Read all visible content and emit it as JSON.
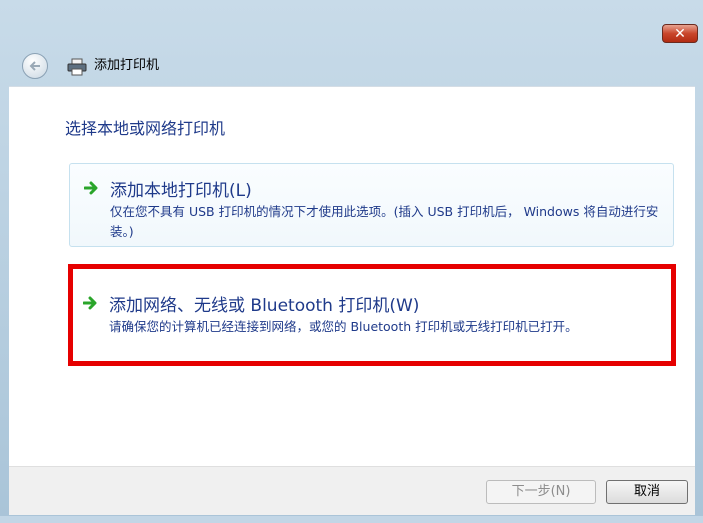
{
  "window": {
    "close_glyph": "✕"
  },
  "nav": {
    "title": "添加打印机"
  },
  "main": {
    "heading": "选择本地或网络打印机",
    "options": [
      {
        "title": "添加本地打印机(L)",
        "description": "仅在您不具有 USB 打印机的情况下才使用此选项。(插入 USB 打印机后， Windows 将自动进行安装。)",
        "icon": "green-arrow-icon",
        "highlighted": false
      },
      {
        "title": "添加网络、无线或 Bluetooth 打印机(W)",
        "description": "请确保您的计算机已经连接到网络，或您的 Bluetooth 打印机或无线打印机已打开。",
        "icon": "green-arrow-icon",
        "highlighted": true
      }
    ]
  },
  "footer": {
    "next_label": "下一步(N)",
    "next_enabled": false,
    "cancel_label": "取消"
  },
  "colors": {
    "accent_text": "#1f3a8a",
    "highlight_border": "#e60000",
    "arrow": "#2aa52a"
  }
}
